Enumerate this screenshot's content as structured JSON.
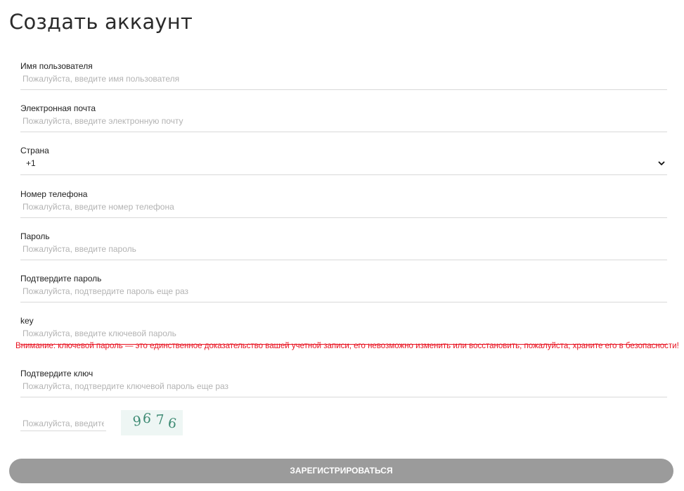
{
  "page": {
    "title": "Создать аккаунт"
  },
  "form": {
    "username": {
      "label": "Имя пользователя",
      "placeholder": "Пожалуйста, введите имя пользователя"
    },
    "email": {
      "label": "Электронная почта",
      "placeholder": "Пожалуйста, введите электронную почту"
    },
    "country": {
      "label": "Страна",
      "selected": "+1",
      "icon": "chevron-down-icon"
    },
    "phone": {
      "label": "Номер телефона",
      "placeholder": "Пожалуйста, введите номер телефона"
    },
    "password": {
      "label": "Пароль",
      "placeholder": "Пожалуйста, введите пароль"
    },
    "confirm_password": {
      "label": "Подтвердите пароль",
      "placeholder": "Пожалуйста, подтвердите пароль еще раз"
    },
    "key": {
      "label": "key",
      "placeholder": "Пожалуйста, введите ключевой пароль"
    },
    "key_warning": "Внимание: ключевой пароль — это единственное доказательство вашей учетной записи, его невозможно изменить или восстановить, пожалуйста, храните его в безопасности!",
    "confirm_key": {
      "label": "Подтвердите ключ",
      "placeholder": "Пожалуйста, подтвердите ключевой пароль еще раз"
    },
    "captcha": {
      "placeholder": "Пожалуйста, введите код",
      "digits": [
        "9",
        "6",
        "7",
        "6"
      ]
    },
    "submit_label": "ЗАРЕГИСТРИРОВАТЬСЯ"
  },
  "colors": {
    "warning": "#e8101e",
    "button_bg": "#9b9b9b",
    "captcha_text": "#3d8a73"
  }
}
